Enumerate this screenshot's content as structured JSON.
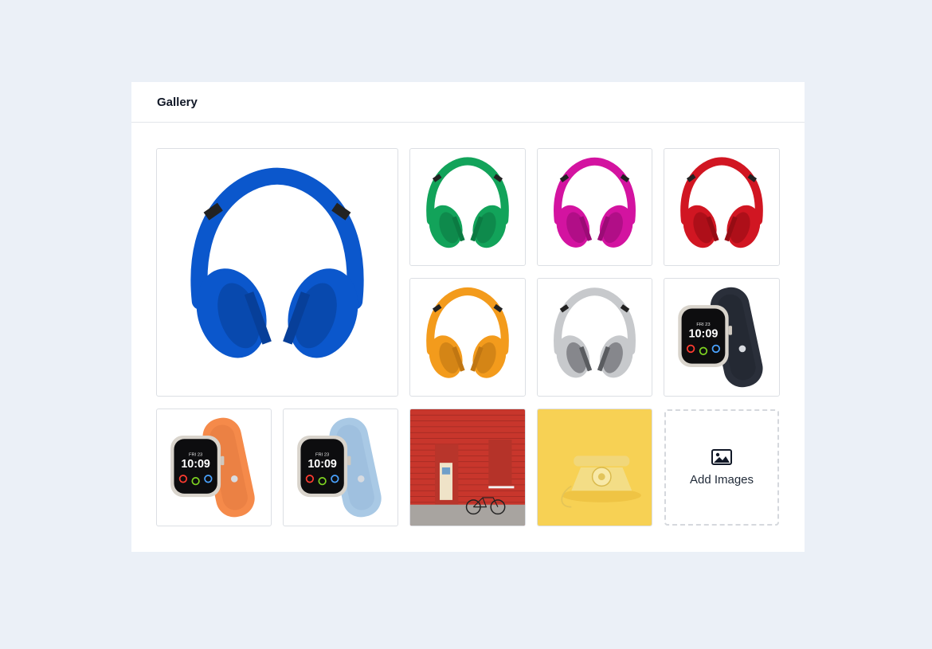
{
  "gallery": {
    "title": "Gallery",
    "add_label": "Add Images",
    "items": [
      {
        "kind": "headphones",
        "color": "#0b57cc",
        "shade": "#073f99"
      },
      {
        "kind": "headphones",
        "color": "#12a35a",
        "shade": "#0b7a42"
      },
      {
        "kind": "headphones",
        "color": "#d313a0",
        "shade": "#9b0c76"
      },
      {
        "kind": "headphones",
        "color": "#d11622",
        "shade": "#960c14"
      },
      {
        "kind": "headphones",
        "color": "#f39b1c",
        "shade": "#c07612"
      },
      {
        "kind": "headphones",
        "color": "#c7c9cc",
        "shade": "#5a5c60"
      },
      {
        "kind": "watch",
        "color": "#2a2f3a",
        "shade": "#1b1f27"
      },
      {
        "kind": "watch",
        "color": "#f58a4a",
        "shade": "#d9713a"
      },
      {
        "kind": "watch",
        "color": "#a9c9e5",
        "shade": "#8bb0d3"
      },
      {
        "kind": "red-wall-photo",
        "color": "#c8362c",
        "shade": "#9f2a22"
      },
      {
        "kind": "yellow-phone-photo",
        "color": "#f7d154",
        "shade": "#e9bb3a"
      }
    ],
    "watch_face": {
      "time": "10:09",
      "label": "FRI 23"
    }
  }
}
